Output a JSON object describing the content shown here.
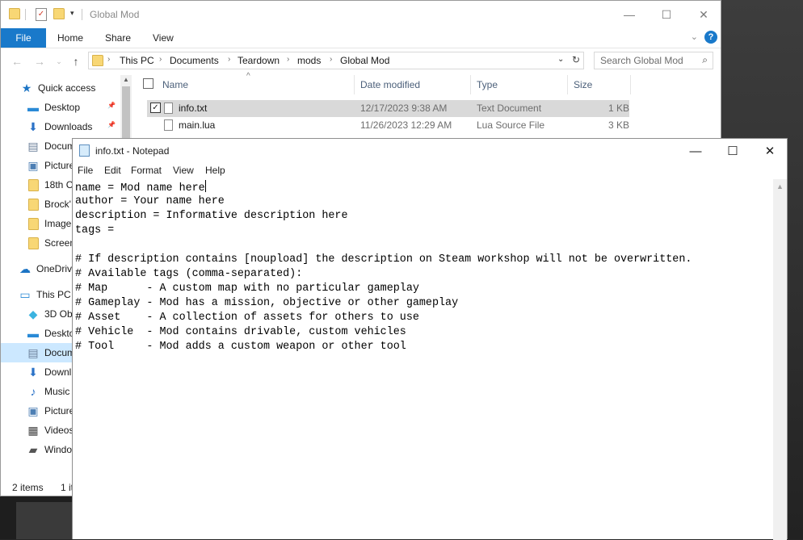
{
  "explorer": {
    "title": "Global Mod",
    "ribbon_tabs": [
      "File",
      "Home",
      "Share",
      "View"
    ],
    "breadcrumb": [
      "This PC",
      "Documents",
      "Teardown",
      "mods",
      "Global Mod"
    ],
    "search_placeholder": "Search Global Mod",
    "columns": {
      "name": "Name",
      "date": "Date modified",
      "type": "Type",
      "size": "Size"
    },
    "files": [
      {
        "name": "info.txt",
        "date": "12/17/2023 9:38 AM",
        "type": "Text Document",
        "size": "1 KB",
        "selected": true
      },
      {
        "name": "main.lua",
        "date": "11/26/2023 12:29 AM",
        "type": "Lua Source File",
        "size": "3 KB",
        "selected": false
      }
    ],
    "nav": [
      {
        "label": "Quick access",
        "icon": "star-icon",
        "color": "#1c74c4"
      },
      {
        "label": "Desktop",
        "icon": "desktop-icon",
        "color": "#2a8ad6"
      },
      {
        "label": "Downloads",
        "icon": "download-icon",
        "color": "#2a72c7"
      },
      {
        "label": "Docum",
        "icon": "document-icon",
        "color": "#6a7f99"
      },
      {
        "label": "Picture",
        "icon": "pictures-icon",
        "color": "#4d7fb4"
      },
      {
        "label": "18th C",
        "icon": "folder-icon",
        "color": "#f8d775"
      },
      {
        "label": "Brock'",
        "icon": "folder-icon",
        "color": "#f8d775"
      },
      {
        "label": "Image",
        "icon": "folder-icon",
        "color": "#f8d775"
      },
      {
        "label": "Screen",
        "icon": "folder-icon",
        "color": "#f8d775"
      },
      {
        "label": "OneDriv",
        "icon": "cloud-icon",
        "color": "#1c74c4"
      },
      {
        "label": "This PC",
        "icon": "computer-icon",
        "color": "#2a8ad6"
      },
      {
        "label": "3D Ob",
        "icon": "cube-icon",
        "color": "#3bb3e0"
      },
      {
        "label": "Deskto",
        "icon": "desktop-icon",
        "color": "#2a8ad6"
      },
      {
        "label": "Docum",
        "icon": "document-icon",
        "color": "#6a7f99"
      },
      {
        "label": "Downl",
        "icon": "download-icon",
        "color": "#2a72c7"
      },
      {
        "label": "Music",
        "icon": "music-icon",
        "color": "#2a72c7"
      },
      {
        "label": "Picture",
        "icon": "pictures-icon",
        "color": "#4d7fb4"
      },
      {
        "label": "Videos",
        "icon": "video-icon",
        "color": "#444444"
      },
      {
        "label": "Windo",
        "icon": "drive-icon",
        "color": "#555555"
      }
    ],
    "status": {
      "count": "2 items",
      "selected": "1 it"
    }
  },
  "notepad": {
    "title": "info.txt - Notepad",
    "menu": [
      "File",
      "Edit",
      "Format",
      "View",
      "Help"
    ],
    "lines": [
      "name = Mod name here",
      "author = Your name here",
      "description = Informative description here",
      "tags = ",
      "",
      "# If description contains [noupload] the description on Steam workshop will not be overwritten.",
      "# Available tags (comma-separated):",
      "# Map      - A custom map with no particular gameplay",
      "# Gameplay - Mod has a mission, objective or other gameplay",
      "# Asset    - A collection of assets for others to use",
      "# Vehicle  - Mod contains drivable, custom vehicles",
      "# Tool     - Mod adds a custom weapon or other tool"
    ]
  }
}
